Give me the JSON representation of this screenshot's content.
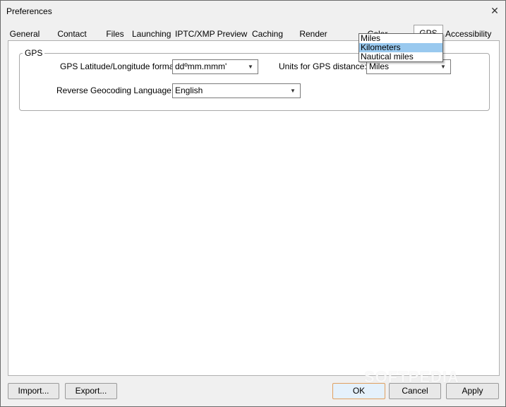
{
  "window": {
    "title": "Preferences",
    "close_glyph": "✕"
  },
  "tabs": [
    {
      "label": "General"
    },
    {
      "label": "Contact Sheet"
    },
    {
      "label": "Files"
    },
    {
      "label": "Launching"
    },
    {
      "label": "IPTC/XMP"
    },
    {
      "label": "Preview"
    },
    {
      "label": "Caching"
    },
    {
      "label": "Render Cache"
    },
    {
      "label": "Color Management"
    },
    {
      "label": "GPS"
    },
    {
      "label": "Accessibility"
    }
  ],
  "active_tab": "GPS",
  "gps_group": {
    "legend": "GPS",
    "latlon_label": "GPS Latitude/Longitude format:",
    "latlon_value": "ddºmm.mmm'",
    "units_label": "Units for GPS distance:",
    "units_value": "Miles",
    "units_options": [
      "Miles",
      "Kilometers",
      "Nautical miles"
    ],
    "units_highlighted": "Kilometers",
    "geocoding_label": "Reverse Geocoding Language:",
    "geocoding_value": "English"
  },
  "buttons": {
    "import": "Import...",
    "export": "Export...",
    "ok": "OK",
    "cancel": "Cancel",
    "apply": "Apply"
  },
  "watermark": "SOFTPEDIA",
  "icons": {
    "dropdown_arrow": "▼"
  }
}
